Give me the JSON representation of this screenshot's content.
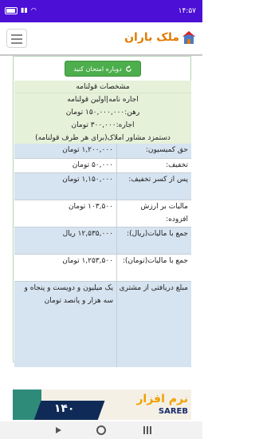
{
  "status_bar": {
    "time": "۱۴:۵۷",
    "battery_icon": "battery-icon",
    "wifi_icon": "wifi-icon",
    "signal_icon": "signal-icon"
  },
  "app_bar": {
    "logo_text": "ملک باران",
    "logo_icon": "house-icon",
    "menu_icon": "hamburger-icon"
  },
  "try_again_button": {
    "label": "دوباره امتحان کنید",
    "icon": "refresh-icon"
  },
  "contract": {
    "header": "مشخصات قولنامه",
    "lines": [
      "اجاره نامه|اولین قولنامه",
      "رهن:۱۵۰,۰۰۰,۰۰۰ تومان",
      "اجاره:۳۰۰,۰۰۰ تومان",
      "دستمزد مشاور املاک(برای هر طرف قولنامه)"
    ]
  },
  "rows": [
    {
      "label": "حق کمیسیون:",
      "value": "۱,۲۰۰,۰۰۰ تومان"
    },
    {
      "label": "تخفیف:",
      "value": "۵۰,۰۰۰ تومان"
    },
    {
      "label": "پس از کسر تخفیف:",
      "value": "۱,۱۵۰,۰۰۰ تومان"
    },
    {
      "label": "مالیات بر ارزش افزوده:",
      "value": "۱۰۳,۵۰۰ تومان"
    },
    {
      "label": "جمع با مالیات(ریال):",
      "value": "۱۲,۵۳۵,۰۰۰ ریال"
    },
    {
      "label": "جمع با مالیات(تومان):",
      "value": "۱,۲۵۳,۵۰۰ تومان"
    },
    {
      "label": "مبلغ دریافتی از مشتری",
      "value": "یک میلیون و دویست و پنجاه و سه هزار و پانصد تومان"
    }
  ],
  "ad": {
    "title": "نرم افزار",
    "site": "SAREB",
    "number": "۱۴۰"
  },
  "nav_bar": {
    "back_icon": "back-icon",
    "home_icon": "home-icon",
    "recent_icon": "recent-apps-icon"
  }
}
